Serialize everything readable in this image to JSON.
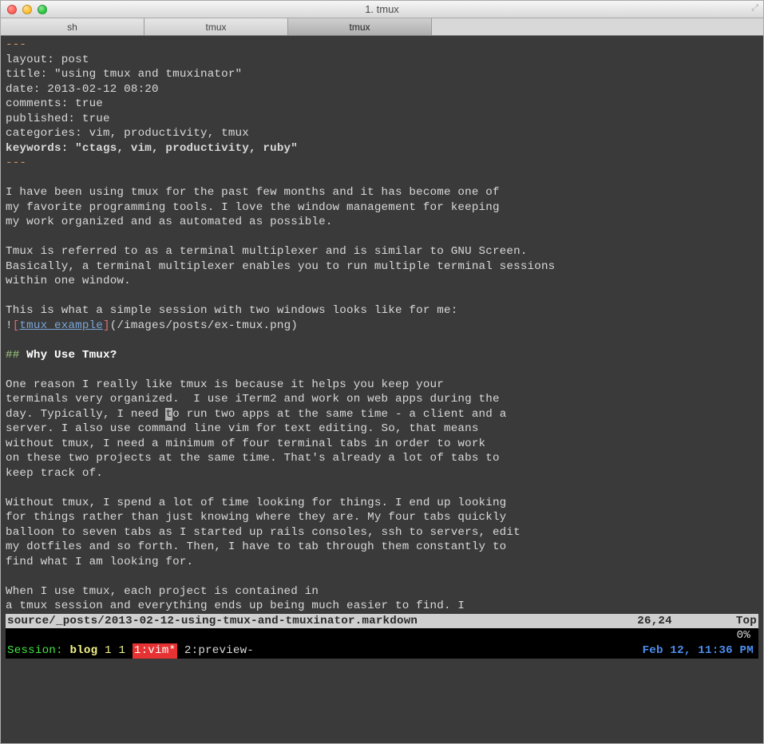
{
  "titlebar": {
    "title": "1. tmux"
  },
  "tabs": [
    {
      "label": "sh",
      "active": false
    },
    {
      "label": "tmux",
      "active": false
    },
    {
      "label": "tmux",
      "active": true
    }
  ],
  "frontmatter": {
    "delim": "---",
    "layout": "layout: post",
    "title": "title: \"using tmux and tmuxinator\"",
    "date": "date: 2013-02-12 08:20",
    "comments": "comments: true",
    "published": "published: true",
    "categories": "categories: vim, productivity, tmux",
    "keywords": "keywords: \"ctags, vim, productivity, ruby\""
  },
  "body": {
    "p1_l1": "I have been using tmux for the past few months and it has become one of",
    "p1_l2": "my favorite programming tools. I love the window management for keeping",
    "p1_l3": "my work organized and as automated as possible.",
    "p2_l1": "Tmux is referred to as a terminal multiplexer and is similar to GNU Screen.",
    "p2_l2": "Basically, a terminal multiplexer enables you to run multiple terminal sessions",
    "p2_l3": "within one window.",
    "p3_l1": "This is what a simple session with two windows looks like for me:",
    "img_bang": "!",
    "img_open": "[",
    "img_text": "tmux example",
    "img_close": "]",
    "img_path": "(/images/posts/ex-tmux.png)",
    "h2_hash": "## ",
    "h2_text": "Why Use Tmux?",
    "p4_l1": "One reason I really like tmux is because it helps you keep your",
    "p4_l2": "terminals very organized.  I use iTerm2 and work on web apps during the",
    "p4_l3a": "day. Typically, I need ",
    "p4_l3_cur": "t",
    "p4_l3b": "o run two apps at the same time - a client and a",
    "p4_l4": "server. I also use command line vim for text editing. So, that means",
    "p4_l5": "without tmux, I need a minimum of four terminal tabs in order to work",
    "p4_l6": "on these two projects at the same time. That's already a lot of tabs to",
    "p4_l7": "keep track of.",
    "p5_l1": "Without tmux, I spend a lot of time looking for things. I end up looking",
    "p5_l2": "for things rather than just knowing where they are. My four tabs quickly",
    "p5_l3": "balloon to seven tabs as I started up rails consoles, ssh to servers, edit",
    "p5_l4": "my dotfiles and so forth. Then, I have to tab through them constantly to",
    "p5_l5": "find what I am looking for.",
    "p6_l1": "When I use tmux, each project is contained in",
    "p6_l2": "a tmux session and everything ends up being much easier to find. I"
  },
  "vim_status": {
    "file": "source/_posts/2013-02-12-using-tmux-and-tmuxinator.markdown",
    "pos": "26,24",
    "pct": "Top"
  },
  "vim_cmd": {
    "percent": "0%"
  },
  "tmux_status": {
    "session_label": "Session: ",
    "session_name": "blog",
    "nums": " 1 1 ",
    "win_active": "1:vim*",
    "win_other": " 2:preview-",
    "time": "Feb 12, 11:36 PM"
  }
}
